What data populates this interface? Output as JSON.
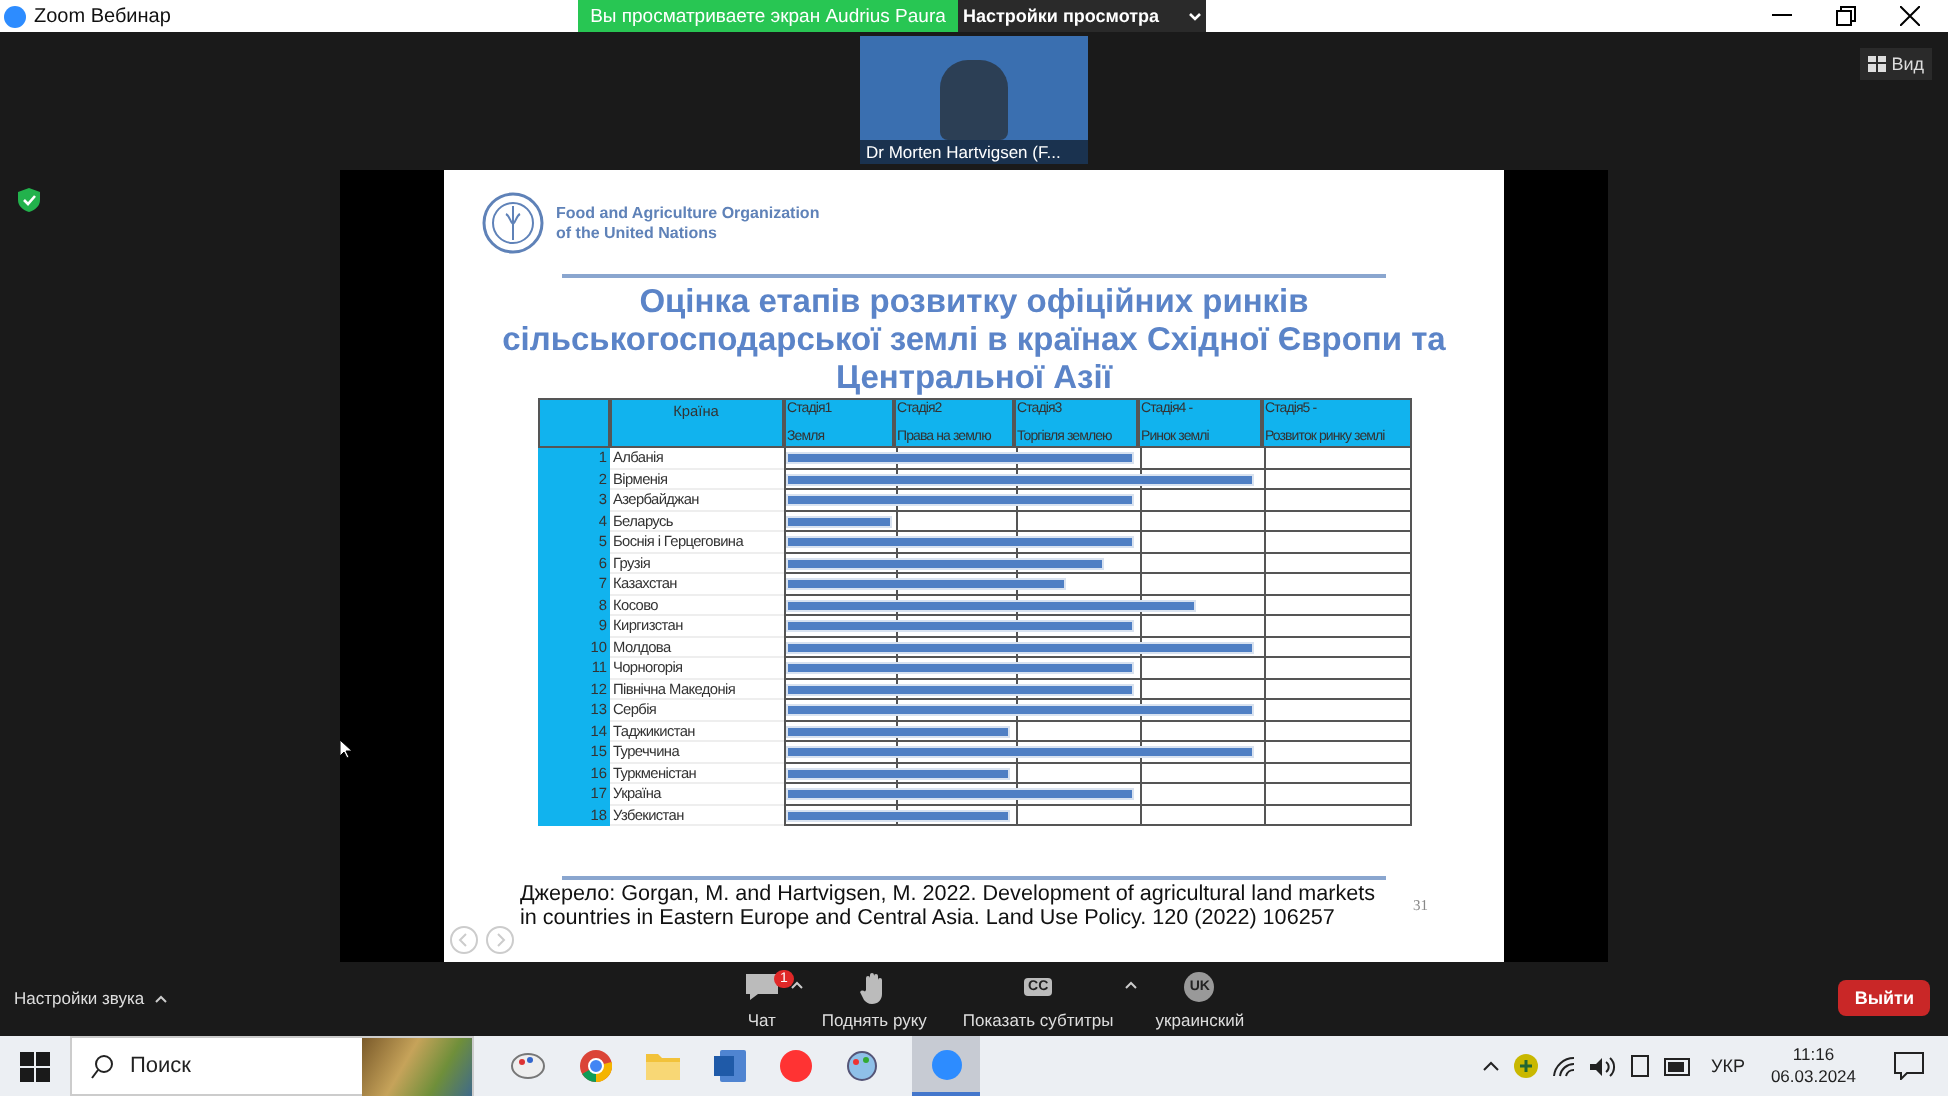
{
  "window": {
    "app_title": "Zoom Вебинар"
  },
  "share_banner": {
    "text": "Вы просматриваете экран Audrius Paura",
    "options_label": "Настройки просмотра"
  },
  "view_button": "Вид",
  "video": {
    "name": "Dr Morten Hartvigsen (F..."
  },
  "slide": {
    "org_line1": "Food and Agriculture Organization",
    "org_line2": "of the United Nations",
    "title": "Оцінка етапів розвитку офіційних ринків сільськогосподарської землі в країнах Східної Європи та Центральної Азії",
    "table": {
      "country_header": "Країна",
      "stages": [
        {
          "line1": "Стадія1",
          "line2": "Земля"
        },
        {
          "line1": "Стадія2",
          "line2": "Права на землю"
        },
        {
          "line1": "Стадія3",
          "line2": "Торгівля землею"
        },
        {
          "line1": "Стадія4 -",
          "line2": "Ринок землі"
        },
        {
          "line1": "Стадія5 -",
          "line2": "Розвиток ринку землі"
        }
      ],
      "rows": [
        {
          "num": "1",
          "country": "Албанія",
          "level": 0.56
        },
        {
          "num": "2",
          "country": "Вірменія",
          "level": 0.75
        },
        {
          "num": "3",
          "country": "Азербайджан",
          "level": 0.56
        },
        {
          "num": "4",
          "country": "Беларусь",
          "level": 0.17
        },
        {
          "num": "5",
          "country": "Боснія і Герцеговина",
          "level": 0.56
        },
        {
          "num": "6",
          "country": "Грузія",
          "level": 0.51
        },
        {
          "num": "7",
          "country": "Казахстан",
          "level": 0.45
        },
        {
          "num": "8",
          "country": "Косово",
          "level": 0.66
        },
        {
          "num": "9",
          "country": "Киргизстан",
          "level": 0.56
        },
        {
          "num": "10",
          "country": "Молдова",
          "level": 0.75
        },
        {
          "num": "11",
          "country": "Чорногорія",
          "level": 0.56
        },
        {
          "num": "12",
          "country": "Північна Македонія",
          "level": 0.56
        },
        {
          "num": "13",
          "country": "Сербія",
          "level": 0.75
        },
        {
          "num": "14",
          "country": "Таджикистан",
          "level": 0.36
        },
        {
          "num": "15",
          "country": "Туреччина",
          "level": 0.75
        },
        {
          "num": "16",
          "country": "Туркменістан",
          "level": 0.36
        },
        {
          "num": "17",
          "country": "Україна",
          "level": 0.56
        },
        {
          "num": "18",
          "country": "Узбекистан",
          "level": 0.36
        }
      ]
    },
    "source": "Джерело: Gorgan, M. and Hartvigsen, M. 2022. Development of agricultural land markets in countries in Eastern Europe and Central Asia. Land Use Policy. 120 (2022) 106257",
    "page": "31"
  },
  "audio_settings": "Настройки звука",
  "toolbar": [
    {
      "kind": "chat",
      "label": "Чат",
      "badge": "1"
    },
    {
      "kind": "hand",
      "label": "Поднять руку"
    },
    {
      "kind": "cc",
      "label": "Показать субтитры",
      "icon_text": "CC"
    },
    {
      "kind": "lang",
      "label": "украинский",
      "icon_text": "UK"
    }
  ],
  "leave_button": "Выйти",
  "taskbar": {
    "search_placeholder": "Поиск",
    "language": "УКР",
    "time": "11:16",
    "date": "06.03.2024"
  }
}
